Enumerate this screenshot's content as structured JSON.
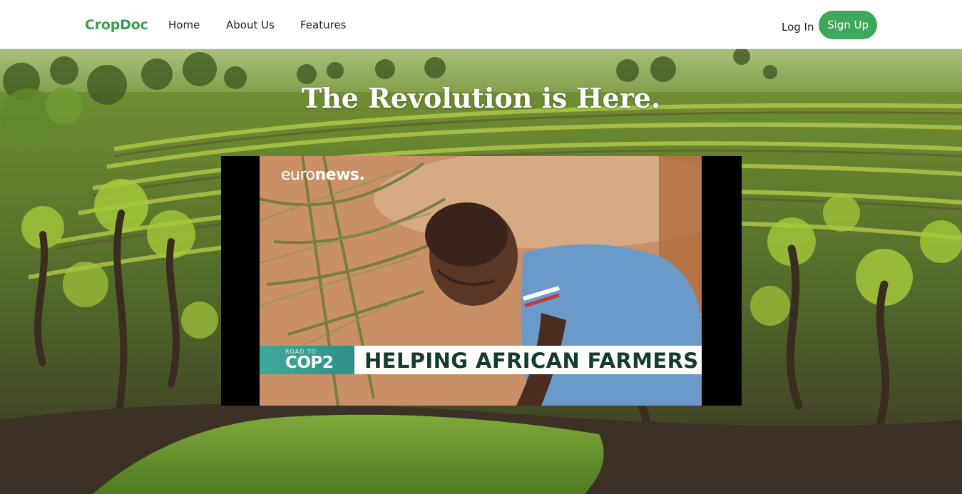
{
  "navbar": {
    "brand": "CropDoc",
    "links": [
      "Home",
      "About Us",
      "Features"
    ],
    "login_label": "Log In",
    "signup_label": "Sign Up",
    "colors": {
      "brand": "#3a9d4e",
      "signup_bg": "#3fa75a"
    }
  },
  "hero": {
    "title": "The Revolution is Here."
  },
  "video": {
    "channel_logo_light": "euro",
    "channel_logo_bold": "news.",
    "tag_small": "ROAD TO",
    "tag_big": "COP2",
    "headline": "HELPING AFRICAN FARMERS"
  }
}
